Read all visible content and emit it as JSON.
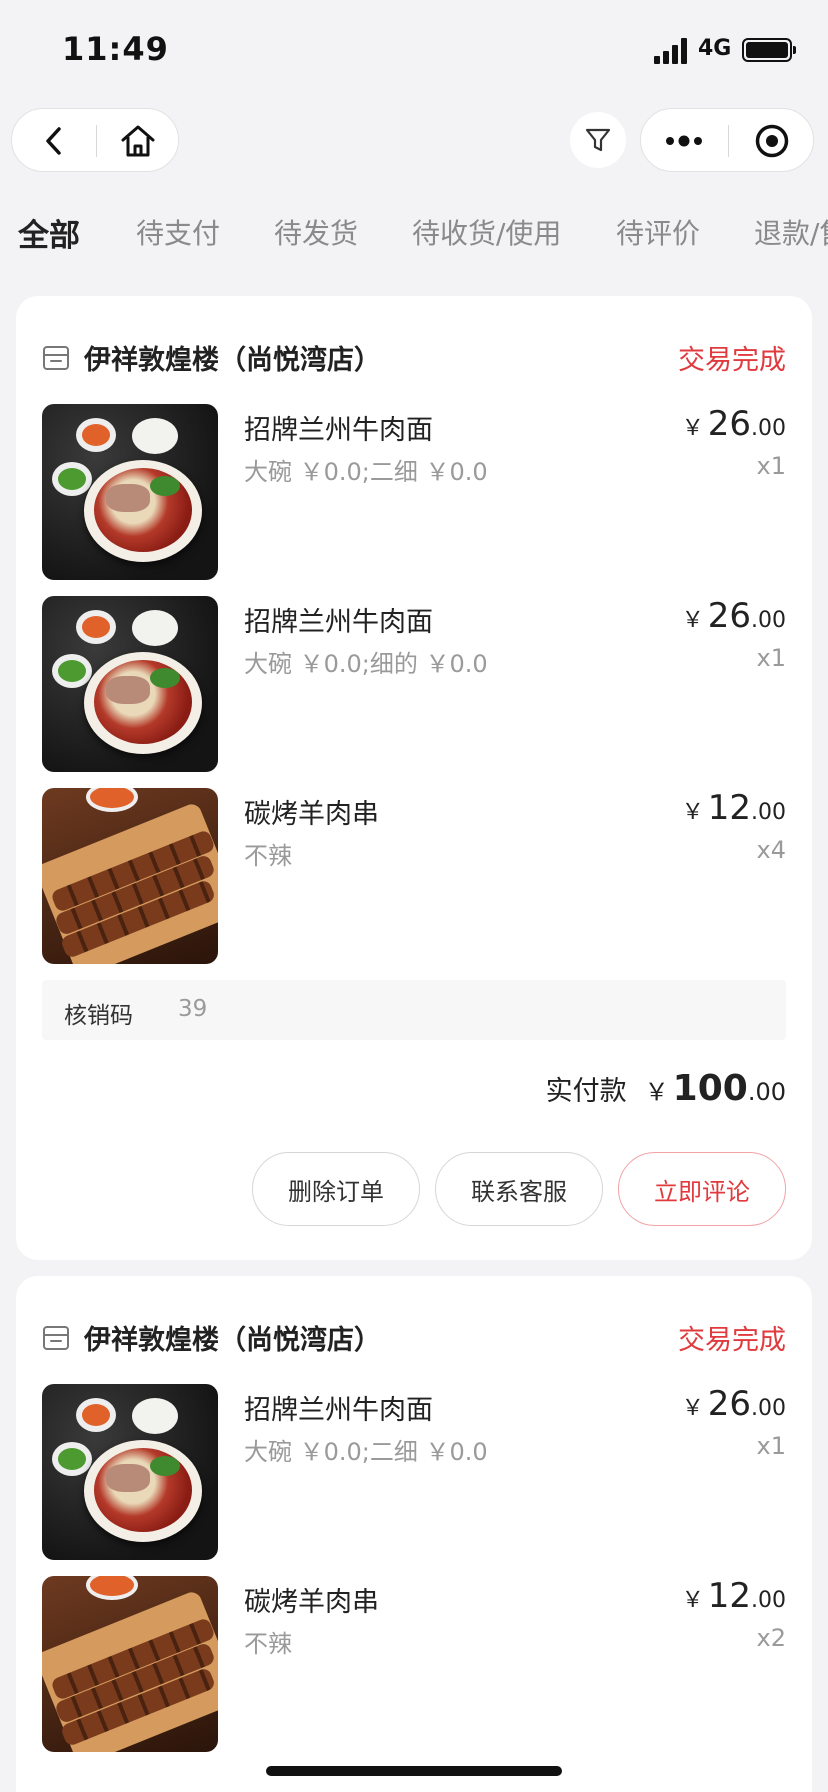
{
  "status_bar": {
    "time": "11:49",
    "network": "4G"
  },
  "nav": {
    "back_icon": "chevron-left-icon",
    "home_icon": "home-icon",
    "filter_icon": "filter-icon",
    "more_icon": "more-dots-icon",
    "close_icon": "target-circle-icon"
  },
  "tabs": [
    {
      "label": "全部",
      "active": true
    },
    {
      "label": "待支付",
      "active": false
    },
    {
      "label": "待发货",
      "active": false
    },
    {
      "label": "待收货/使用",
      "active": false
    },
    {
      "label": "待评价",
      "active": false
    },
    {
      "label": "退款/售后",
      "active": false
    }
  ],
  "orders": [
    {
      "store_name": "伊祥敦煌楼（尚悦湾店）",
      "status": "交易完成",
      "items": [
        {
          "name": "招牌兰州牛肉面",
          "spec": "大碗 ￥0.0;二细 ￥0.0",
          "currency": "￥",
          "price_int": "26",
          "price_dec": ".00",
          "qty": "x1",
          "image": "noodle"
        },
        {
          "name": "招牌兰州牛肉面",
          "spec": "大碗 ￥0.0;细的 ￥0.0",
          "currency": "￥",
          "price_int": "26",
          "price_dec": ".00",
          "qty": "x1",
          "image": "noodle"
        },
        {
          "name": "碳烤羊肉串",
          "spec": "不辣",
          "currency": "￥",
          "price_int": "12",
          "price_dec": ".00",
          "qty": "x4",
          "image": "kebab"
        }
      ],
      "verify_code_label": "核销码",
      "verify_code": "39",
      "paid_label": "实付款",
      "paid_currency": "￥",
      "paid_int": "100",
      "paid_dec": ".00",
      "buttons": {
        "delete": "删除订单",
        "contact": "联系客服",
        "review": "立即评论"
      }
    },
    {
      "store_name": "伊祥敦煌楼（尚悦湾店）",
      "status": "交易完成",
      "items": [
        {
          "name": "招牌兰州牛肉面",
          "spec": "大碗 ￥0.0;二细 ￥0.0",
          "currency": "￥",
          "price_int": "26",
          "price_dec": ".00",
          "qty": "x1",
          "image": "noodle"
        },
        {
          "name": "碳烤羊肉串",
          "spec": "不辣",
          "currency": "￥",
          "price_int": "12",
          "price_dec": ".00",
          "qty": "x2",
          "image": "kebab"
        }
      ]
    }
  ],
  "colors": {
    "accent": "#e03a3e",
    "background": "#f3f3f5",
    "card": "#ffffff",
    "muted_text": "#9a9a9a"
  }
}
